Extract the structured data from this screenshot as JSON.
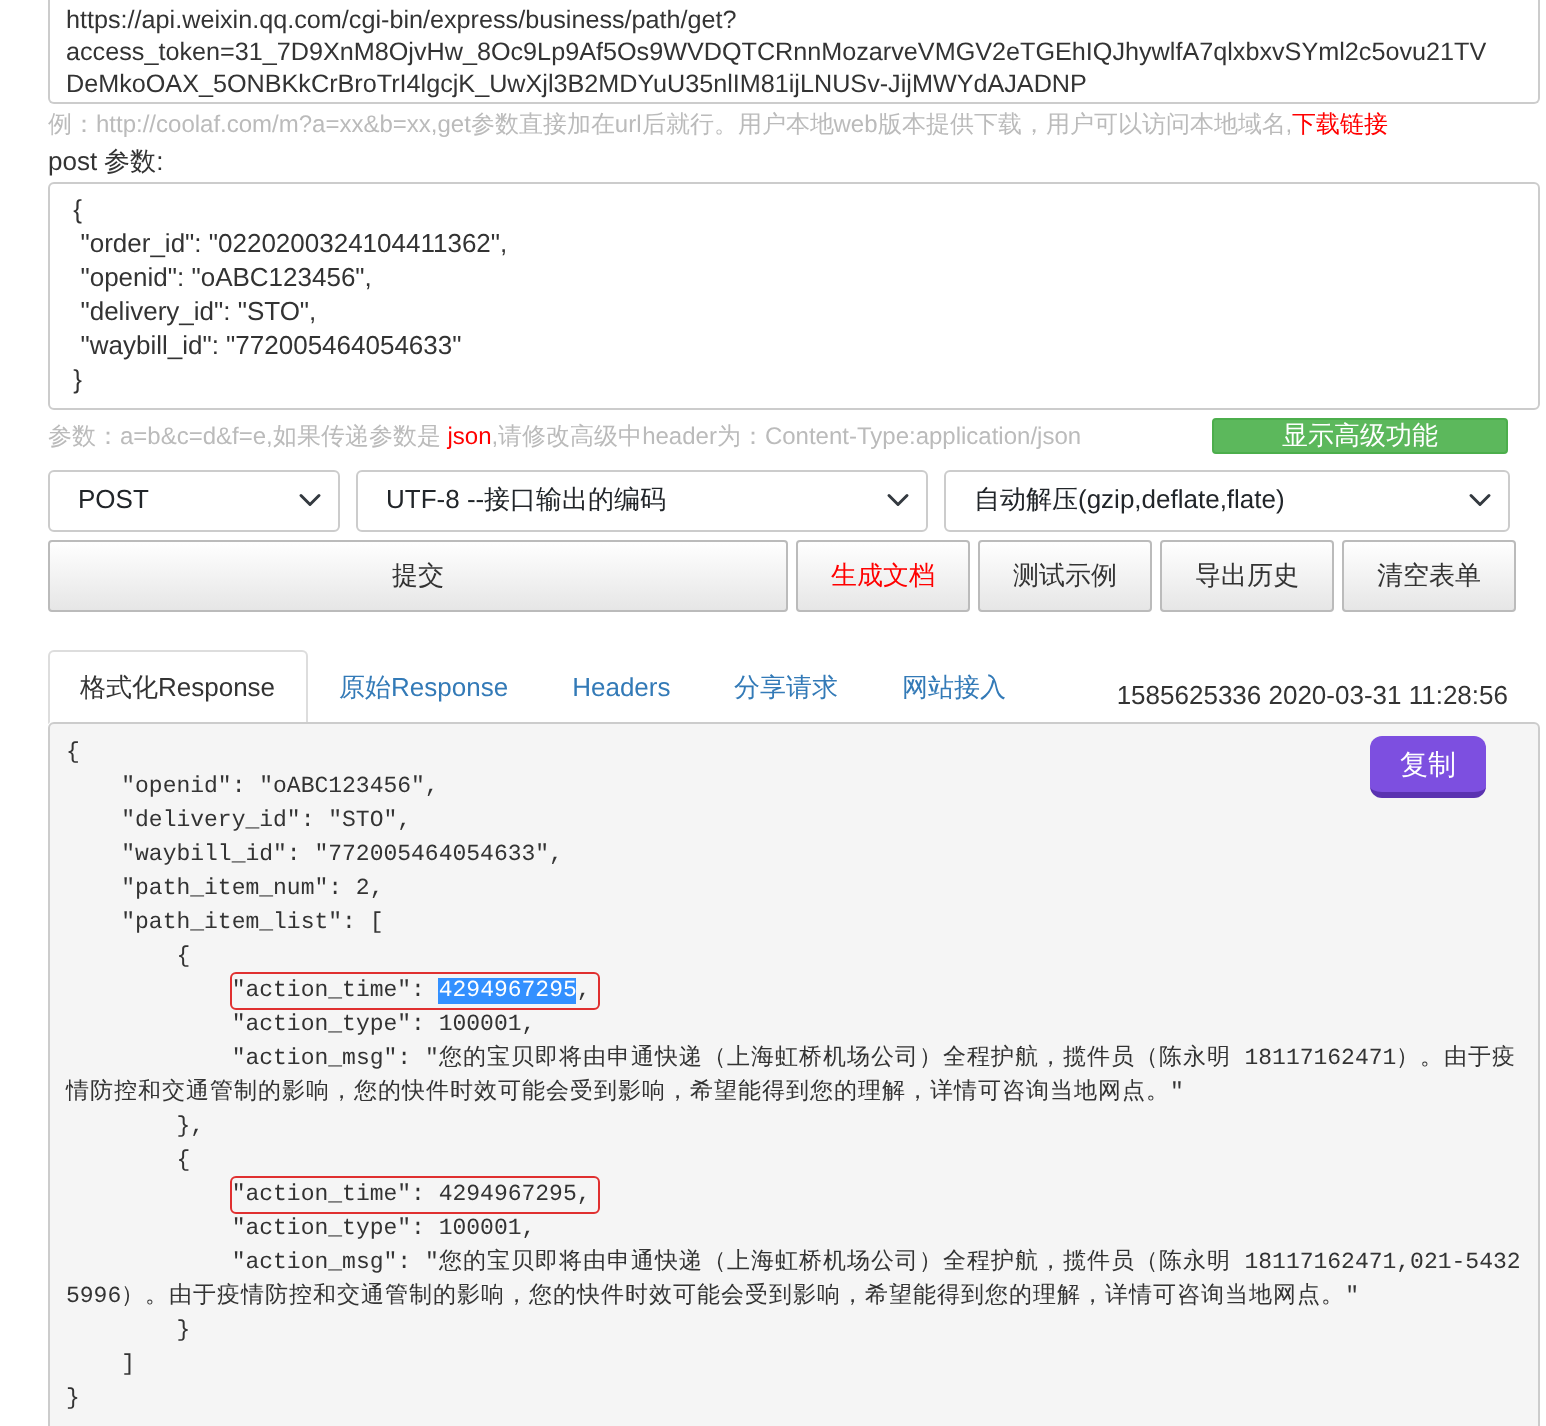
{
  "url_field": {
    "value": "https://api.weixin.qq.com/cgi-bin/express/business/path/get?\naccess_token=31_7D9XnM8OjvHw_8Oc9Lp9Af5Os9WVDQTCRnnMozarveVMGV2eTGEhIQJhywlfA7qlxbxvSYml2c5ovu21TVDeMkoOAX_5ONBKkCrBroTrI4lgcjK_UwXjl3B2MDYuU35nlIM81ijLNUSv-JijMWYdAJADNP"
  },
  "url_hint": {
    "text": "例：http://coolaf.com/m?a=xx&b=xx,get参数直接加在url后就行。用户本地web版本提供下载，用户可以访问本地域名,",
    "link": "下载链接"
  },
  "post_label": "post 参数:",
  "post_field": {
    "value": " {\n  \"order_id\": \"0220200324104411362\",\n  \"openid\": \"oABC123456\",\n  \"delivery_id\": \"STO\",\n  \"waybill_id\": \"772005464054633\"\n }"
  },
  "post_hint": "参数：a=b&c=d&f=e,如果传递参数是 **json**,请修改高级中header为：Content-Type:application/json",
  "advanced_button": "显示高级功能",
  "selects": [
    {
      "value": "POST"
    },
    {
      "value": "UTF-8 --接口输出的编码"
    },
    {
      "value": "自动解压(gzip,deflate,flate)"
    }
  ],
  "buttons": [
    {
      "label": "提交",
      "kind": "wide"
    },
    {
      "label": "生成文档",
      "kind": "red"
    },
    {
      "label": "测试示例",
      "kind": "plain"
    },
    {
      "label": "导出历史",
      "kind": "plain"
    },
    {
      "label": "清空表单",
      "kind": "plain"
    }
  ],
  "tabs": [
    {
      "label": "格式化Response",
      "selected": true
    },
    {
      "label": "原始Response",
      "selected": false
    },
    {
      "label": "Headers",
      "selected": false
    },
    {
      "label": "分享请求",
      "selected": false
    },
    {
      "label": "网站接入",
      "selected": false
    }
  ],
  "timestamp": "1585625336 2020-03-31 11:28:56",
  "copy_button": "复制",
  "response_lines": [
    {
      "parts": [
        {
          "text": "{"
        }
      ]
    },
    {
      "parts": [
        {
          "text": "    \"openid\": \"oABC123456\","
        }
      ]
    },
    {
      "parts": [
        {
          "text": "    \"delivery_id\": \"STO\","
        }
      ]
    },
    {
      "parts": [
        {
          "text": "    \"waybill_id\": \"772005464054633\","
        }
      ]
    },
    {
      "parts": [
        {
          "text": "    \"path_item_num\": 2,"
        }
      ]
    },
    {
      "parts": [
        {
          "text": "    \"path_item_list\": ["
        }
      ]
    },
    {
      "parts": [
        {
          "text": "        {"
        }
      ]
    },
    {
      "boxed": true,
      "parts": [
        {
          "text": "            \"action_time\": "
        },
        {
          "text": "4294967295",
          "selected": true
        },
        {
          "text": ","
        }
      ]
    },
    {
      "parts": [
        {
          "text": "            \"action_type\": 100001,"
        }
      ]
    },
    {
      "parts": [
        {
          "text": "            \"action_msg\": \"您的宝贝即将由申通快递（上海虹桥机场公司）全程护航，揽件员（陈永明 18117162471）。由于疫情防控和交通管制的影响，您的快件时效可能会受到影响，希望能得到您的理解，详情可咨询当地网点。\""
        }
      ]
    },
    {
      "parts": [
        {
          "text": "        },"
        }
      ]
    },
    {
      "parts": [
        {
          "text": "        {"
        }
      ]
    },
    {
      "boxed": true,
      "parts": [
        {
          "text": "            \"action_time\": 4294967295,"
        }
      ]
    },
    {
      "parts": [
        {
          "text": "            \"action_type\": 100001,"
        }
      ]
    },
    {
      "parts": [
        {
          "text": "            \"action_msg\": \"您的宝贝即将由申通快递（上海虹桥机场公司）全程护航，揽件员（陈永明 18117162471,021-54325996）。由于疫情防控和交通管制的影响，您的快件时效可能会受到影响，希望能得到您的理解，详情可咨询当地网点。\""
        }
      ]
    },
    {
      "parts": [
        {
          "text": "        }"
        }
      ]
    },
    {
      "parts": [
        {
          "text": "    ]"
        }
      ]
    },
    {
      "parts": [
        {
          "text": "}"
        }
      ]
    }
  ]
}
